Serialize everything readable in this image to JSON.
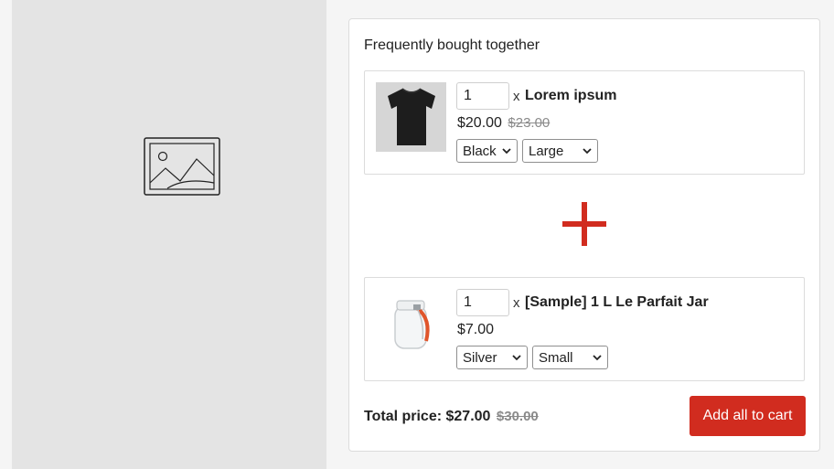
{
  "placeholder": {
    "icon": "image-placeholder-icon"
  },
  "bundle": {
    "title": "Frequently bought together",
    "items": [
      {
        "quantity": "1",
        "times": "x",
        "name": "Lorem ipsum",
        "price": "$20.00",
        "old_price": "$23.00",
        "thumbnail": "black-tshirt",
        "options": [
          "Black",
          "Large"
        ]
      },
      {
        "quantity": "1",
        "times": "x",
        "name": "[Sample] 1 L Le Parfait Jar",
        "price": "$7.00",
        "old_price": "",
        "thumbnail": "glass-jar",
        "options": [
          "Silver",
          "Small"
        ]
      }
    ],
    "plus_icon": "plus-icon",
    "total": {
      "label": "Total price:",
      "value": "$27.00",
      "old_value": "$30.00"
    },
    "add_all_label": "Add all to cart"
  },
  "colors": {
    "accent": "#d12c1f",
    "panel_bg": "#e4e4e4",
    "strike": "#8a8a8a"
  }
}
